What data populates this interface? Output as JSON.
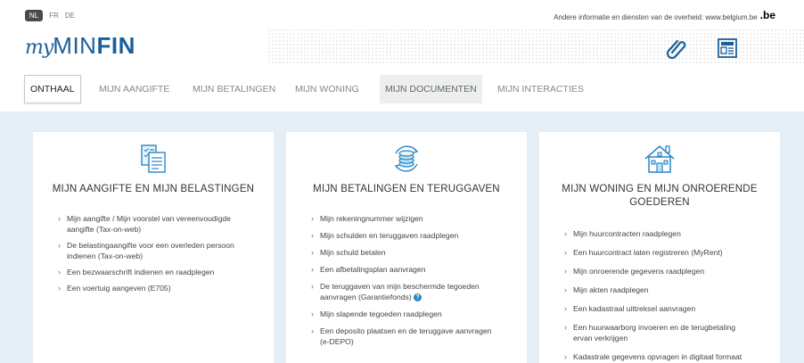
{
  "topbar": {
    "languages": [
      {
        "code": "NL",
        "active": true
      },
      {
        "code": "FR",
        "active": false
      },
      {
        "code": "DE",
        "active": false
      }
    ],
    "gov_info": "Andere informatie en diensten van de overheid: www.belgium.be",
    "be_logo": ".be"
  },
  "header": {
    "logo_my": "my",
    "logo_min": "MIN",
    "logo_fin": "FIN",
    "icons": [
      "paperclip-icon",
      "news-icon"
    ]
  },
  "nav": {
    "items": [
      {
        "label": "ONTHAAL",
        "state": "active"
      },
      {
        "label": "MIJN AANGIFTE",
        "state": "normal"
      },
      {
        "label": "MIJN BETALINGEN",
        "state": "normal"
      },
      {
        "label": "MIJN WONING",
        "state": "normal"
      },
      {
        "label": "MIJN DOCUMENTEN",
        "state": "highlighted"
      },
      {
        "label": "MIJN INTERACTIES",
        "state": "normal"
      }
    ]
  },
  "cards": [
    {
      "icon": "tax-form-icon",
      "title": "MIJN AANGIFTE EN MIJN BELASTINGEN",
      "links": [
        {
          "lines": [
            "Mijn aangifte / Mijn voorstel van vereenvoudigde",
            "aangifte (Tax-on-web)"
          ]
        },
        {
          "lines": [
            "De belastingaangifte voor een overleden persoon",
            "indienen (Tax-on-web)"
          ]
        },
        {
          "lines": [
            "Een bezwaarschrift indienen en raadplegen"
          ]
        },
        {
          "lines": [
            "Een voertuig aangeven (E705)"
          ]
        }
      ]
    },
    {
      "icon": "coins-refresh-icon",
      "title": "MIJN BETALINGEN EN TERUGGAVEN",
      "links": [
        {
          "lines": [
            "Mijn rekeningnummer wijzigen"
          ]
        },
        {
          "lines": [
            "Mijn schulden en teruggaven raadplegen"
          ]
        },
        {
          "lines": [
            "Mijn schuld betalen"
          ]
        },
        {
          "lines": [
            "Een afbetalingsplan aanvragen"
          ]
        },
        {
          "lines": [
            "De teruggaven van mijn beschermde tegoeden",
            "aanvragen (Garantiefonds)"
          ],
          "help": "?"
        },
        {
          "lines": [
            "Mijn slapende tegoeden raadplegen"
          ]
        },
        {
          "lines": [
            "Een deposito plaatsen en de teruggave aanvragen",
            "(e-DEPO)"
          ]
        }
      ]
    },
    {
      "icon": "house-icon",
      "title_lines": [
        "MIJN WONING EN MIJN ONROERENDE",
        "GOEDEREN"
      ],
      "links": [
        {
          "lines": [
            "Mijn huurcontracten raadplegen"
          ]
        },
        {
          "lines": [
            "Een huurcontract laten registreren (MyRent)"
          ]
        },
        {
          "lines": [
            "Mijn onroerende gegevens raadplegen"
          ]
        },
        {
          "lines": [
            "Mijn akten raadplegen"
          ]
        },
        {
          "lines": [
            "Een kadastraal uittreksel aanvragen"
          ]
        },
        {
          "lines": [
            "Een huurwaarborg invoeren en de terugbetaling",
            "ervan verkrijgen"
          ]
        },
        {
          "lines": [
            "Kadastrale gegevens opvragen in digitaal formaat"
          ]
        }
      ]
    }
  ],
  "colors": {
    "brand": "#1a5f9a",
    "accent": "#2b86c4",
    "content_bg": "#e3eff4"
  }
}
